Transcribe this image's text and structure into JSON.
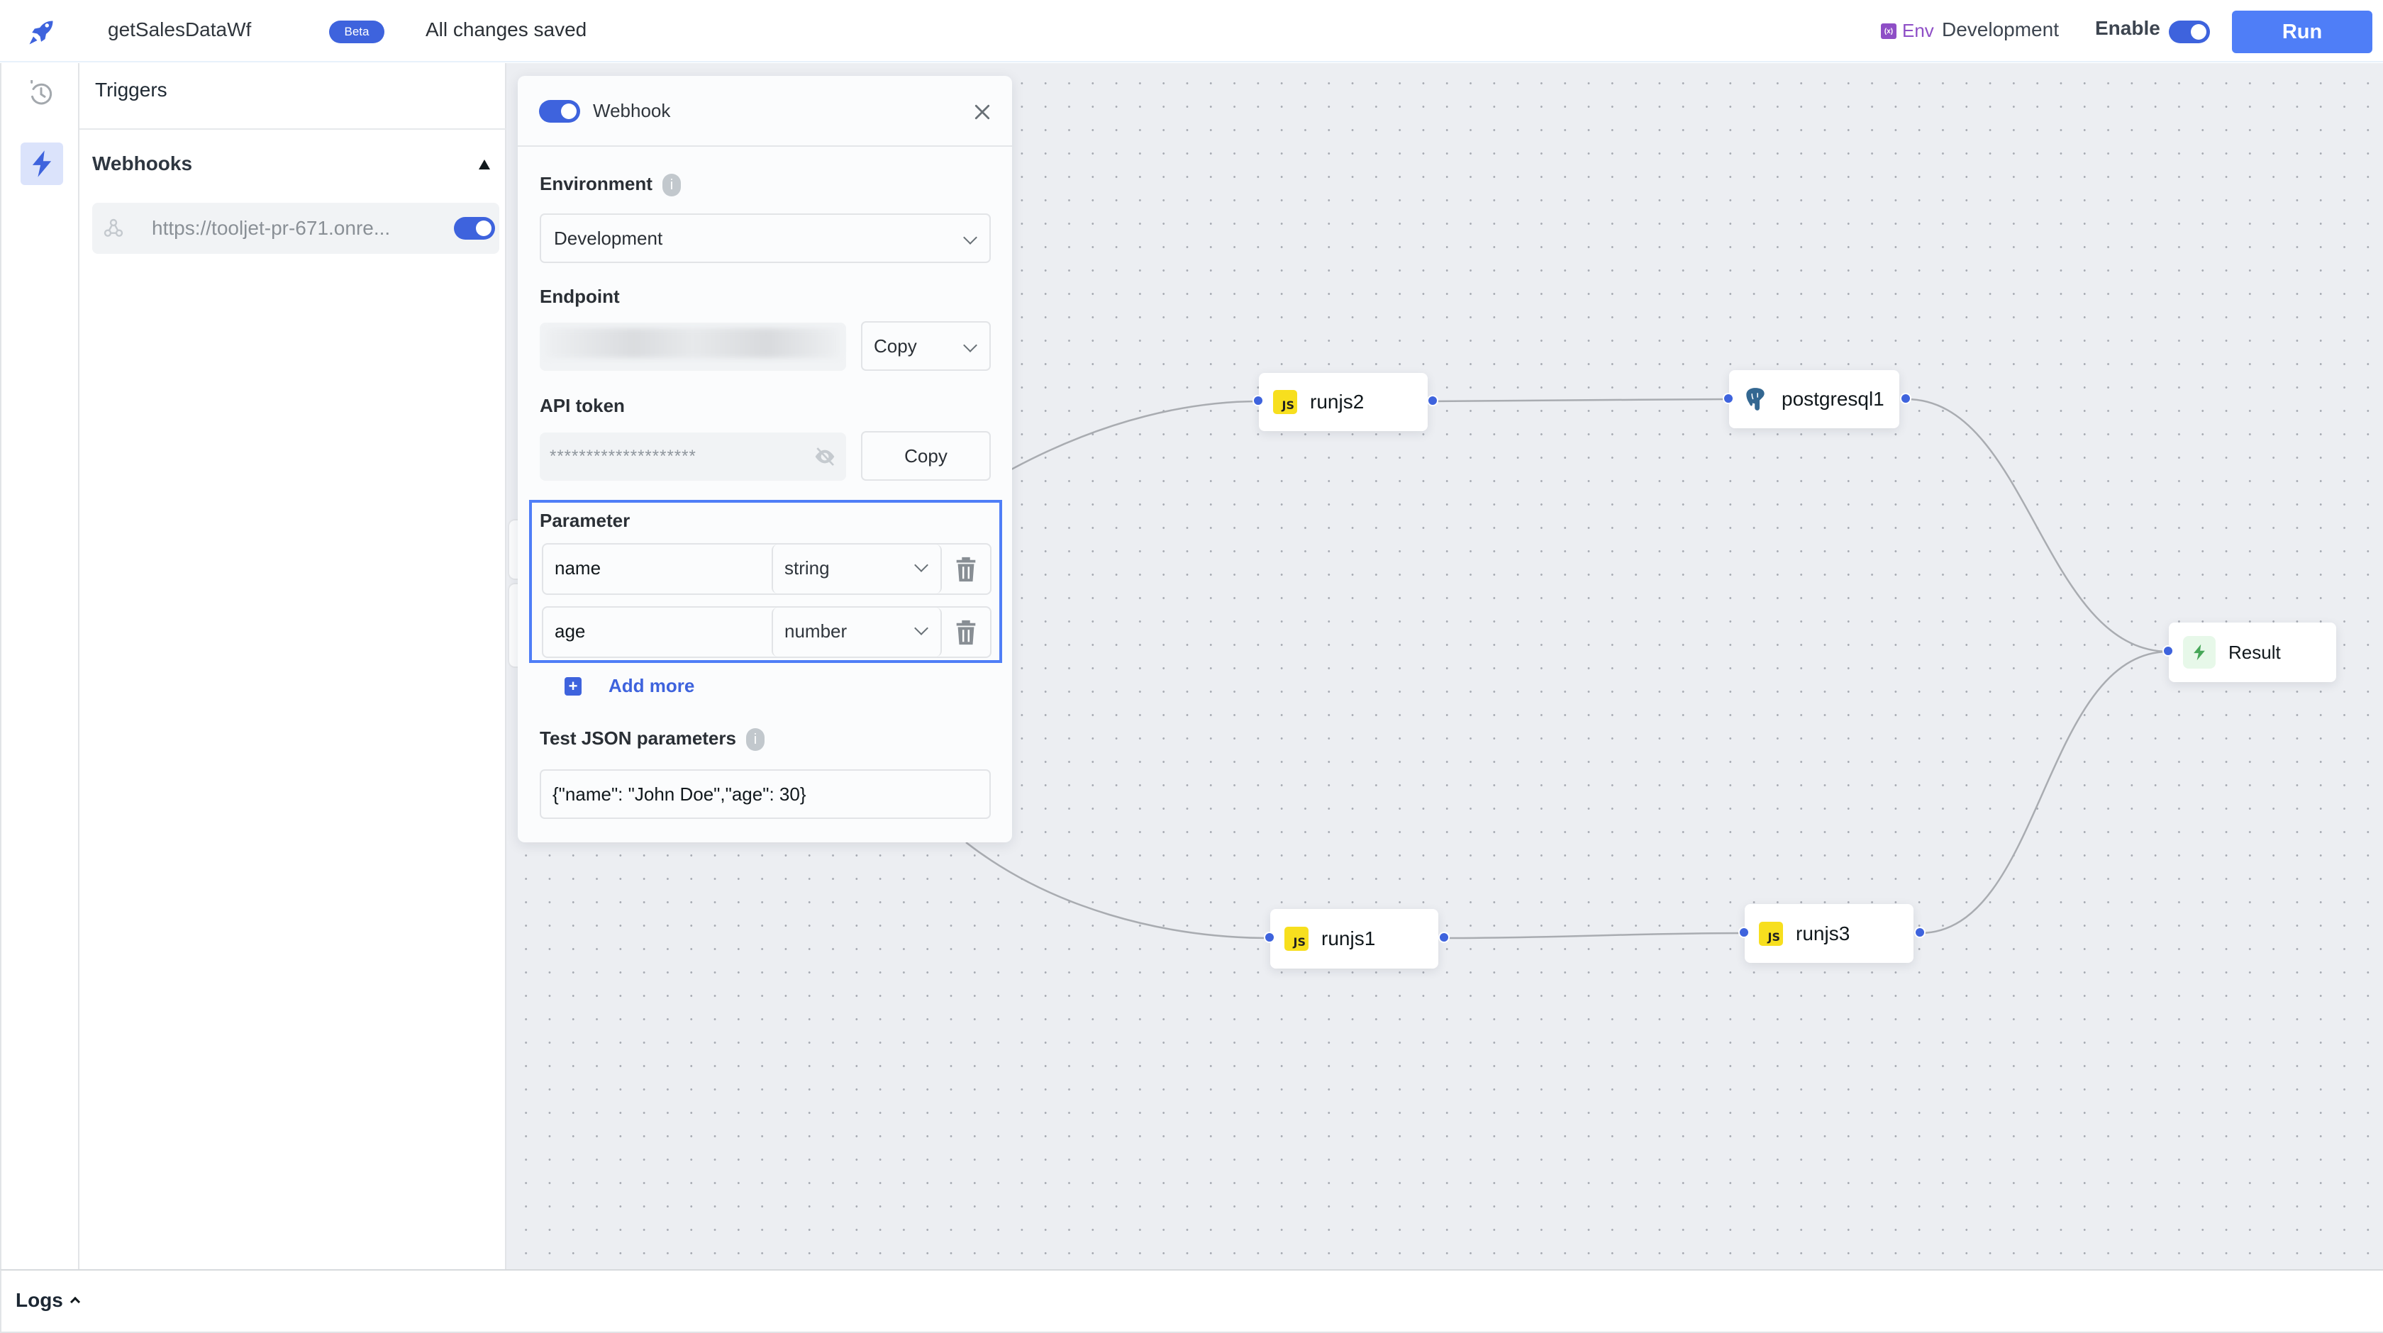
{
  "header": {
    "app_name": "getSalesDataWf",
    "badge": "Beta",
    "save_status": "All changes saved",
    "env_label": "Env",
    "env_value": "Development",
    "enable_label": "Enable",
    "enabled": true,
    "run_label": "Run",
    "icons": {
      "logo": "rocket-icon",
      "env": "variable-icon"
    }
  },
  "rail": {
    "items": [
      {
        "name": "history",
        "icon": "history-icon",
        "active": false
      },
      {
        "name": "triggers",
        "icon": "lightning-icon",
        "active": true
      }
    ]
  },
  "triggers_panel": {
    "title": "Triggers",
    "section": "Webhooks",
    "webhooks": [
      {
        "url": "https://tooljet-pr-671.onre...",
        "enabled": true,
        "icon": "webhook-icon"
      }
    ]
  },
  "webhook_panel": {
    "title": "Webhook",
    "enabled": true,
    "environment": {
      "label": "Environment",
      "value": "Development"
    },
    "endpoint": {
      "label": "Endpoint",
      "copy_label": "Copy"
    },
    "api_token": {
      "label": "API token",
      "value": "********************",
      "copy_label": "Copy"
    },
    "parameters": {
      "label": "Parameter",
      "items": [
        {
          "name": "name",
          "type": "string"
        },
        {
          "name": "age",
          "type": "number"
        }
      ],
      "add_more_label": "Add more"
    },
    "test_json": {
      "label": "Test JSON parameters",
      "value": "{\"name\": \"John Doe\",\"age\": 30}"
    }
  },
  "workflow": {
    "nodes": [
      {
        "id": "runjs2",
        "label": "runjs2",
        "kind": "javascript"
      },
      {
        "id": "postgresql1",
        "label": "postgresql1",
        "kind": "postgresql"
      },
      {
        "id": "result",
        "label": "Result",
        "kind": "result"
      },
      {
        "id": "runjs1",
        "label": "runjs1",
        "kind": "javascript"
      },
      {
        "id": "runjs3",
        "label": "runjs3",
        "kind": "javascript"
      }
    ],
    "edges": [
      {
        "from": "trigger",
        "to": "runjs2"
      },
      {
        "from": "runjs2",
        "to": "postgresql1"
      },
      {
        "from": "postgresql1",
        "to": "result"
      },
      {
        "from": "trigger",
        "to": "runjs1"
      },
      {
        "from": "runjs1",
        "to": "runjs3"
      },
      {
        "from": "runjs3",
        "to": "result"
      }
    ],
    "js_badge": "JS"
  },
  "logs": {
    "label": "Logs"
  },
  "colors": {
    "accent": "#3e63dd",
    "run_button": "#4f7ef7",
    "env": "#8e4ec6",
    "js": "#f7df1e",
    "result": "#46a758"
  }
}
